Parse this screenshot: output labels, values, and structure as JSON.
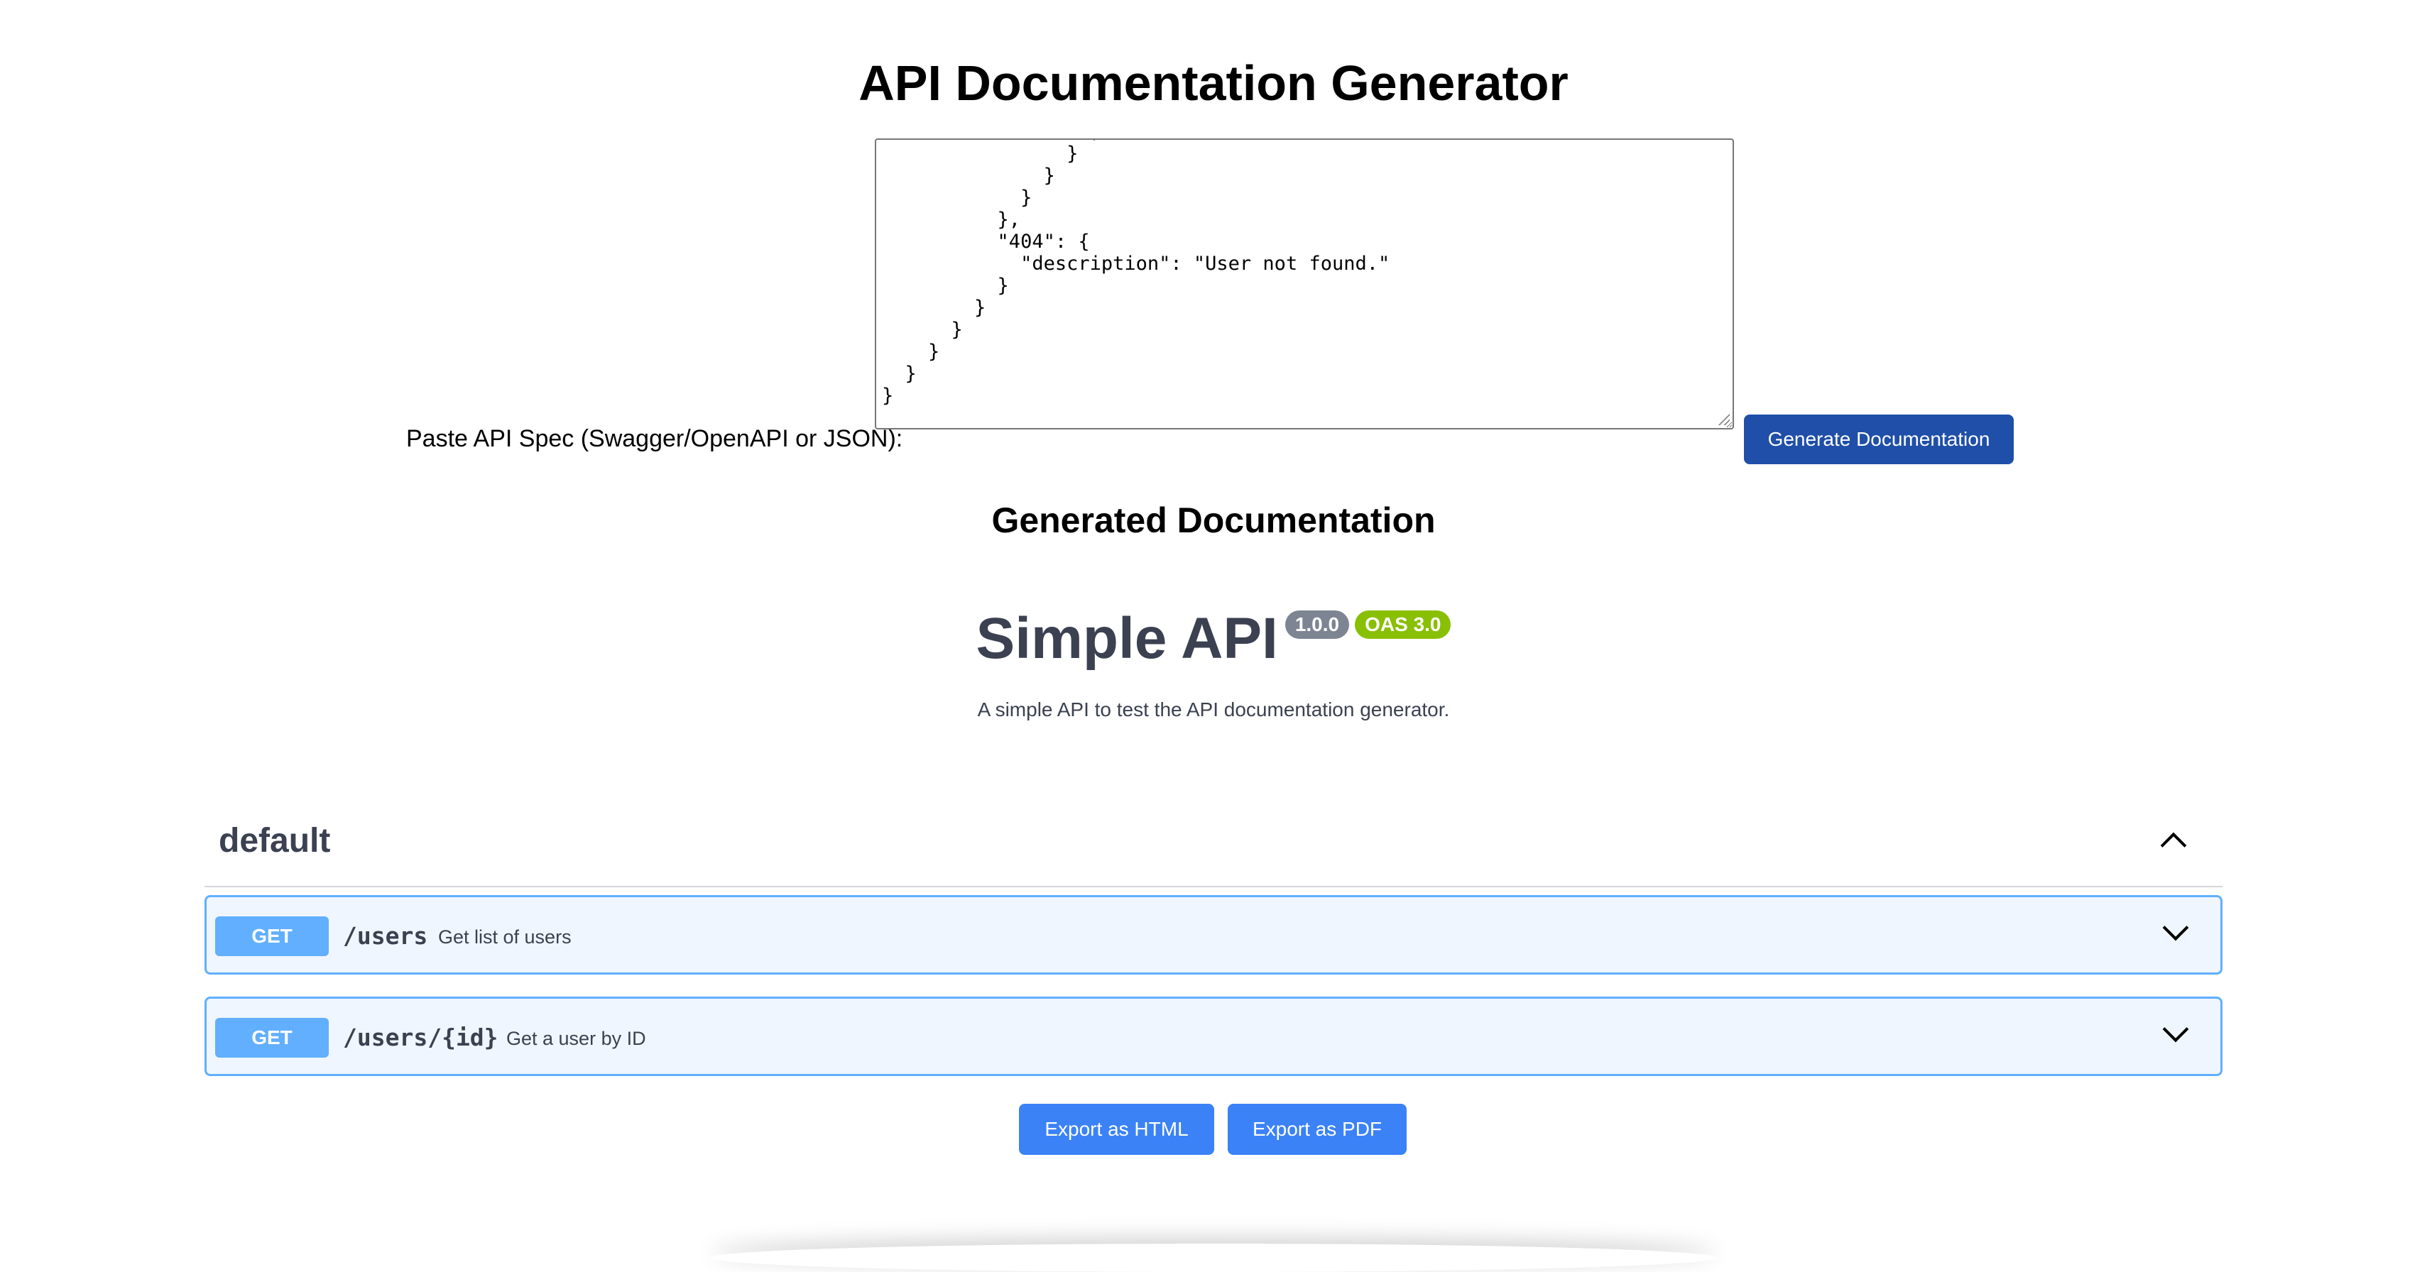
{
  "page": {
    "title": "API Documentation Generator"
  },
  "spec_input": {
    "label": "Paste API Spec (Swagger/OpenAPI or JSON):",
    "visible_text": "                  ,\n                }\n              }\n            }\n          },\n          \"404\": {\n            \"description\": \"User not found.\"\n          }\n        }\n      }\n    }\n  }\n}"
  },
  "generate_button": {
    "label": "Generate Documentation"
  },
  "output": {
    "section_title": "Generated Documentation",
    "api_title": "Simple API",
    "version_badge": "1.0.0",
    "oas_badge": "OAS 3.0",
    "description": "A simple API to test the API documentation generator.",
    "tag": {
      "name": "default"
    },
    "operations": [
      {
        "method": "GET",
        "path": "/users",
        "summary": "Get list of users"
      },
      {
        "method": "GET",
        "path": "/users/{id}",
        "summary": "Get a user by ID"
      }
    ]
  },
  "export": {
    "html_label": "Export as HTML",
    "pdf_label": "Export as PDF"
  },
  "colors": {
    "generate_button": "#1f4fa8",
    "export_button": "#3b82f6",
    "get_method": "#61affe",
    "get_row_bg": "#eff6ff",
    "version_badge": "#7d8492",
    "oas_badge": "#89bf04",
    "swagger_text": "#3b4151"
  },
  "icons": {
    "tag_toggle": "chevron-up-icon",
    "operation_toggle": "chevron-down-icon",
    "textarea_resize": "resize-grip-icon"
  }
}
